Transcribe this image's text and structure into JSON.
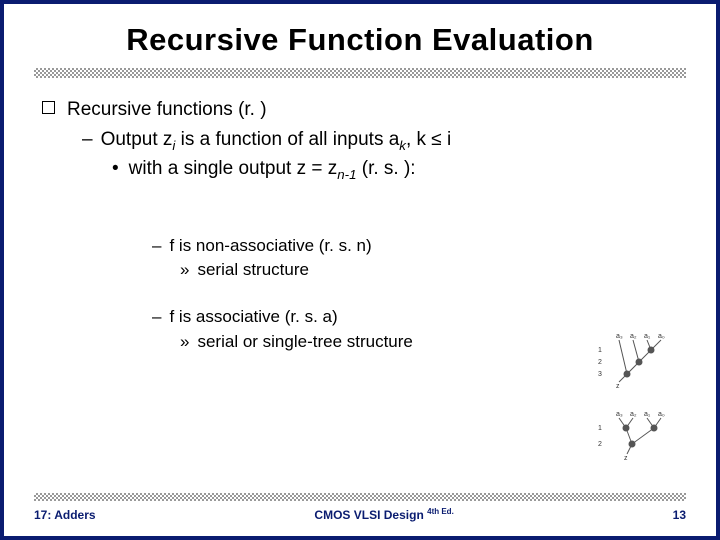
{
  "title": "Recursive Function Evaluation",
  "bullets": {
    "main": "Recursive functions (r. )",
    "sub1_pre": "Output z",
    "sub1_i": "i",
    "sub1_mid": " is a function of all inputs a",
    "sub1_k": "k",
    "sub1_post": ", k ≤ i",
    "sub2_pre": "with a single output z = z",
    "sub2_n1": "n-1",
    "sub2_post": " (r. s. ):"
  },
  "block1": {
    "line": "f is non-associative (r. s. n)",
    "sub": "serial structure"
  },
  "block2": {
    "line": "f is associative (r. s. a)",
    "sub": "serial or single-tree structure"
  },
  "footer": {
    "left": "17: Adders",
    "center": "CMOS VLSI Design",
    "edition": "4th Ed.",
    "right": "13"
  },
  "diagram_labels": {
    "a3": "a₃",
    "a2": "a₂",
    "a1": "a₁",
    "a0": "a₀",
    "n1": "1",
    "n2": "2",
    "n3": "3",
    "z": "z"
  }
}
